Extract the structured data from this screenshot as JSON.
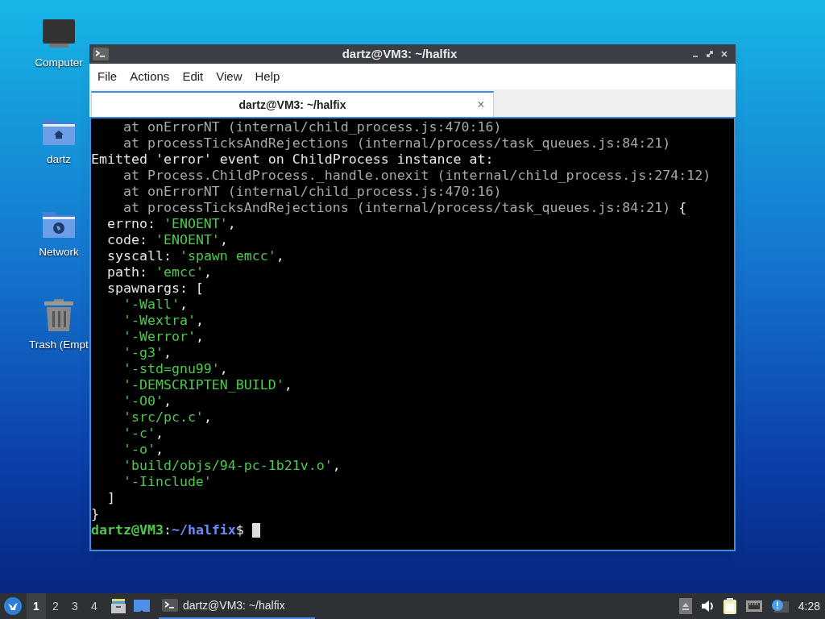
{
  "desktop_icons": [
    {
      "kind": "computer",
      "label": "Computer"
    },
    {
      "kind": "home",
      "label": "dartz"
    },
    {
      "kind": "network",
      "label": "Network"
    },
    {
      "kind": "trash",
      "label": "Trash (Empt"
    }
  ],
  "window": {
    "title": "dartz@VM3: ~/halfix",
    "menu": [
      "File",
      "Actions",
      "Edit",
      "View",
      "Help"
    ],
    "tabs": [
      {
        "label": "dartz@VM3: ~/halfix",
        "selected": true,
        "close": "×"
      }
    ],
    "lines": [
      [
        {
          "kind": "dim",
          "text": "    at onErrorNT (internal/child_process.js:470:16)"
        }
      ],
      [
        {
          "kind": "dim",
          "text": "    at processTicksAndRejections (internal/process/task_queues.js:84:21)"
        }
      ],
      [
        {
          "kind": "plain",
          "text": "Emitted 'error' event on ChildProcess instance at:"
        }
      ],
      [
        {
          "kind": "dim",
          "text": "    at Process.ChildProcess._handle.onexit (internal/child_process.js:274:12)"
        }
      ],
      [
        {
          "kind": "dim",
          "text": "    at onErrorNT (internal/child_process.js:470:16)"
        }
      ],
      [
        {
          "kind": "dim",
          "text": "    at processTicksAndRejections (internal/process/task_queues.js:84:21)"
        },
        {
          "kind": "plain",
          "text": " {"
        }
      ],
      [
        {
          "kind": "plain",
          "text": "  errno: "
        },
        {
          "kind": "string",
          "text": "'ENOENT'"
        },
        {
          "kind": "plain",
          "text": ","
        }
      ],
      [
        {
          "kind": "plain",
          "text": "  code: "
        },
        {
          "kind": "string",
          "text": "'ENOENT'"
        },
        {
          "kind": "plain",
          "text": ","
        }
      ],
      [
        {
          "kind": "plain",
          "text": "  syscall: "
        },
        {
          "kind": "string",
          "text": "'spawn emcc'"
        },
        {
          "kind": "plain",
          "text": ","
        }
      ],
      [
        {
          "kind": "plain",
          "text": "  path: "
        },
        {
          "kind": "string",
          "text": "'emcc'"
        },
        {
          "kind": "plain",
          "text": ","
        }
      ],
      [
        {
          "kind": "plain",
          "text": "  spawnargs: ["
        }
      ],
      [
        {
          "kind": "string",
          "text": "    '-Wall'"
        },
        {
          "kind": "plain",
          "text": ","
        }
      ],
      [
        {
          "kind": "string",
          "text": "    '-Wextra'"
        },
        {
          "kind": "plain",
          "text": ","
        }
      ],
      [
        {
          "kind": "string",
          "text": "    '-Werror'"
        },
        {
          "kind": "plain",
          "text": ","
        }
      ],
      [
        {
          "kind": "string",
          "text": "    '-g3'"
        },
        {
          "kind": "plain",
          "text": ","
        }
      ],
      [
        {
          "kind": "string",
          "text": "    '-std=gnu99'"
        },
        {
          "kind": "plain",
          "text": ","
        }
      ],
      [
        {
          "kind": "string",
          "text": "    '-DEMSCRIPTEN_BUILD'"
        },
        {
          "kind": "plain",
          "text": ","
        }
      ],
      [
        {
          "kind": "string",
          "text": "    '-O0'"
        },
        {
          "kind": "plain",
          "text": ","
        }
      ],
      [
        {
          "kind": "string",
          "text": "    'src/pc.c'"
        },
        {
          "kind": "plain",
          "text": ","
        }
      ],
      [
        {
          "kind": "string",
          "text": "    '-c'"
        },
        {
          "kind": "plain",
          "text": ","
        }
      ],
      [
        {
          "kind": "string",
          "text": "    '-o'"
        },
        {
          "kind": "plain",
          "text": ","
        }
      ],
      [
        {
          "kind": "string",
          "text": "    'build/objs/94-pc-1b21v.o'"
        },
        {
          "kind": "plain",
          "text": ","
        }
      ],
      [
        {
          "kind": "string",
          "text": "    '-Iinclude'"
        }
      ],
      [
        {
          "kind": "plain",
          "text": "  ]"
        }
      ],
      [
        {
          "kind": "plain",
          "text": "}"
        }
      ]
    ],
    "prompt": {
      "user_host": "dartz@VM3",
      "separator": ":",
      "path": "~/halfix",
      "symbol": "$"
    }
  },
  "taskbar": {
    "workspaces": [
      {
        "label": "1",
        "selected": true
      },
      {
        "label": "2",
        "selected": false
      },
      {
        "label": "3",
        "selected": false
      },
      {
        "label": "4",
        "selected": false
      }
    ],
    "task": {
      "label": "dartz@VM3: ~/halfix",
      "selected": true
    },
    "clock": "4:28"
  }
}
